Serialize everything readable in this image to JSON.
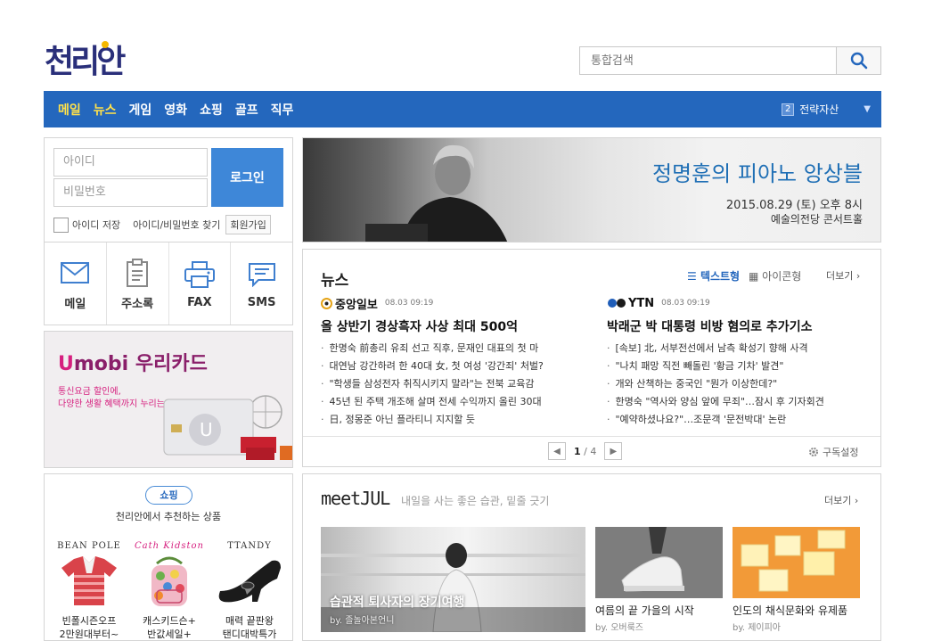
{
  "brand": {
    "logo": "천리안"
  },
  "search": {
    "placeholder": "통합검색"
  },
  "gnb": {
    "items": [
      {
        "label": "메일",
        "highlight": true
      },
      {
        "label": "뉴스",
        "highlight": true
      },
      {
        "label": "게임",
        "highlight": false
      },
      {
        "label": "영화",
        "highlight": false
      },
      {
        "label": "쇼핑",
        "highlight": false
      },
      {
        "label": "골프",
        "highlight": false
      },
      {
        "label": "직무",
        "highlight": false
      }
    ],
    "rank_number": "2",
    "rank_keyword": "전략자산",
    "rank_arrow": "▼"
  },
  "login": {
    "id_placeholder": "아이디",
    "pw_placeholder": "비밀번호",
    "login_label": "로그인",
    "remember_label": "아이디 저장",
    "find_label": "아이디/비밀번호 찾기",
    "join_label": "회원가입"
  },
  "quick": {
    "mail": "메일",
    "address": "주소록",
    "fax": "FAX",
    "sms": "SMS"
  },
  "ad": {
    "title_u": "U",
    "title_rest": "mobi 우리카드",
    "desc_line1": "통신요금 할인에,",
    "desc_line2": "다양한 생활 혜택까지 누리는"
  },
  "shop": {
    "badge": "쇼핑",
    "subtitle": "천리안에서 추천하는 상품",
    "products": [
      {
        "brand": "BEAN POLE",
        "name_line1": "빈폴시즌오프",
        "name_line2": "2만원대부터~"
      },
      {
        "brand": "Cath Kidston",
        "name_line1": "캐스키드슨+",
        "name_line2": "반값세일+"
      },
      {
        "brand": "TTANDY",
        "name_line1": "매력 끝판왕",
        "name_line2": "탠디대박특가"
      }
    ]
  },
  "banner": {
    "title": "정명훈의 피아노 앙상블",
    "date": "2015.08.29 (토) 오후 8시",
    "place": "예술의전당 콘서트홀"
  },
  "news": {
    "title": "뉴스",
    "view_text": "텍스트형",
    "view_icon": "아이콘형",
    "more": "더보기",
    "columns": [
      {
        "source": "중앙일보",
        "time": "08.03 09:19",
        "headline": "올 상반기 경상흑자 사상 최대 500억",
        "items": [
          "한명숙 前총리 유죄 선고 직후, 문재인 대표의 첫 마",
          "대연남 강간하려 한 40대 女, 첫 여성 '강간죄' 처벌?",
          "\"학생들 삼성전자 취직시키지 말라\"는 전북 교육감",
          "45년 된 주택 개조해 살며 전세 수익까지 올린 30대",
          "日, 정몽준 아닌 플라티니 지지할 듯"
        ]
      },
      {
        "source": "YTN",
        "time": "08.03 09:19",
        "headline": "박래군 박 대통령 비방 혐의로 추가기소",
        "items": [
          "[속보] 北, 서부전선에서 남측 확성기 향해 사격",
          "\"나치 패망 직전 빼돌린 '황금 기차' 발견\"",
          "개와 산책하는 중국인 \"뭔가 이상한데?\"",
          "한명숙 \"역사와 양심 앞에 무죄\"…잠시 후 기자회견",
          "\"예약하셨나요?\"…조문객 '문전박대' 논란"
        ]
      }
    ],
    "page_current": "1",
    "page_total": "4",
    "settings": "구독설정"
  },
  "meet": {
    "logo": "meetJUL",
    "desc": "내일을 사는 좋은 습관, 밑줄 긋기",
    "more": "더보기",
    "feature_caption": "습관적 퇴사자의 장기여행",
    "feature_by": "by. 졸놀아본언니",
    "cards": [
      {
        "caption": "여름의 끝 가을의 시작",
        "by": "by. 오버룩즈"
      },
      {
        "caption": "인도의 채식문화와 유제품",
        "by": "by. 제이피아"
      }
    ]
  }
}
